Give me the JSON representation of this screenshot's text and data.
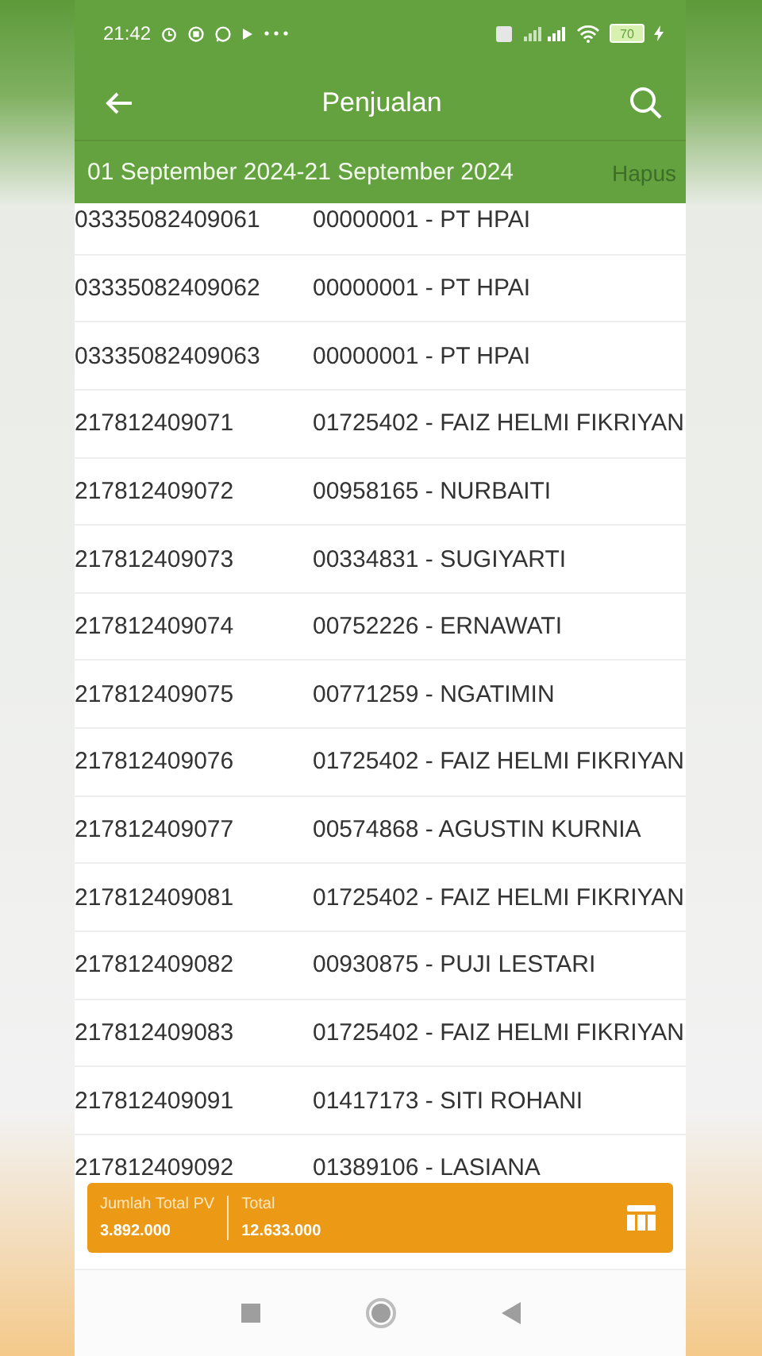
{
  "status_bar": {
    "time": "21:42",
    "battery": "70"
  },
  "header": {
    "title": "Penjualan"
  },
  "filter": {
    "date_range": "01 September 2024-21 September 2024",
    "clear_label": "Hapus"
  },
  "rows": [
    {
      "invoice": "03335082409061",
      "member": "00000001 - PT HPAI"
    },
    {
      "invoice": "03335082409062",
      "member": "00000001 - PT HPAI"
    },
    {
      "invoice": "03335082409063",
      "member": "00000001 - PT HPAI"
    },
    {
      "invoice": "217812409071",
      "member": "01725402 - FAIZ HELMI FIKRIYAN"
    },
    {
      "invoice": "217812409072",
      "member": "00958165 - NURBAITI"
    },
    {
      "invoice": "217812409073",
      "member": "00334831 - SUGIYARTI"
    },
    {
      "invoice": "217812409074",
      "member": "00752226 - ERNAWATI"
    },
    {
      "invoice": "217812409075",
      "member": "00771259 - NGATIMIN"
    },
    {
      "invoice": "217812409076",
      "member": "01725402 - FAIZ HELMI FIKRIYAN"
    },
    {
      "invoice": "217812409077",
      "member": "00574868 - AGUSTIN KURNIA"
    },
    {
      "invoice": "217812409081",
      "member": "01725402 - FAIZ HELMI FIKRIYAN"
    },
    {
      "invoice": "217812409082",
      "member": "00930875 - PUJI LESTARI"
    },
    {
      "invoice": "217812409083",
      "member": "01725402 - FAIZ HELMI FIKRIYAN"
    },
    {
      "invoice": "217812409091",
      "member": "01417173 - SITI ROHANI"
    },
    {
      "invoice": "217812409092",
      "member": "01389106 - LASIANA"
    }
  ],
  "summary": [
    {
      "label": "Jumlah Total PV",
      "value": "3.892.000"
    },
    {
      "label": "Total",
      "value": "12.633.000"
    }
  ]
}
